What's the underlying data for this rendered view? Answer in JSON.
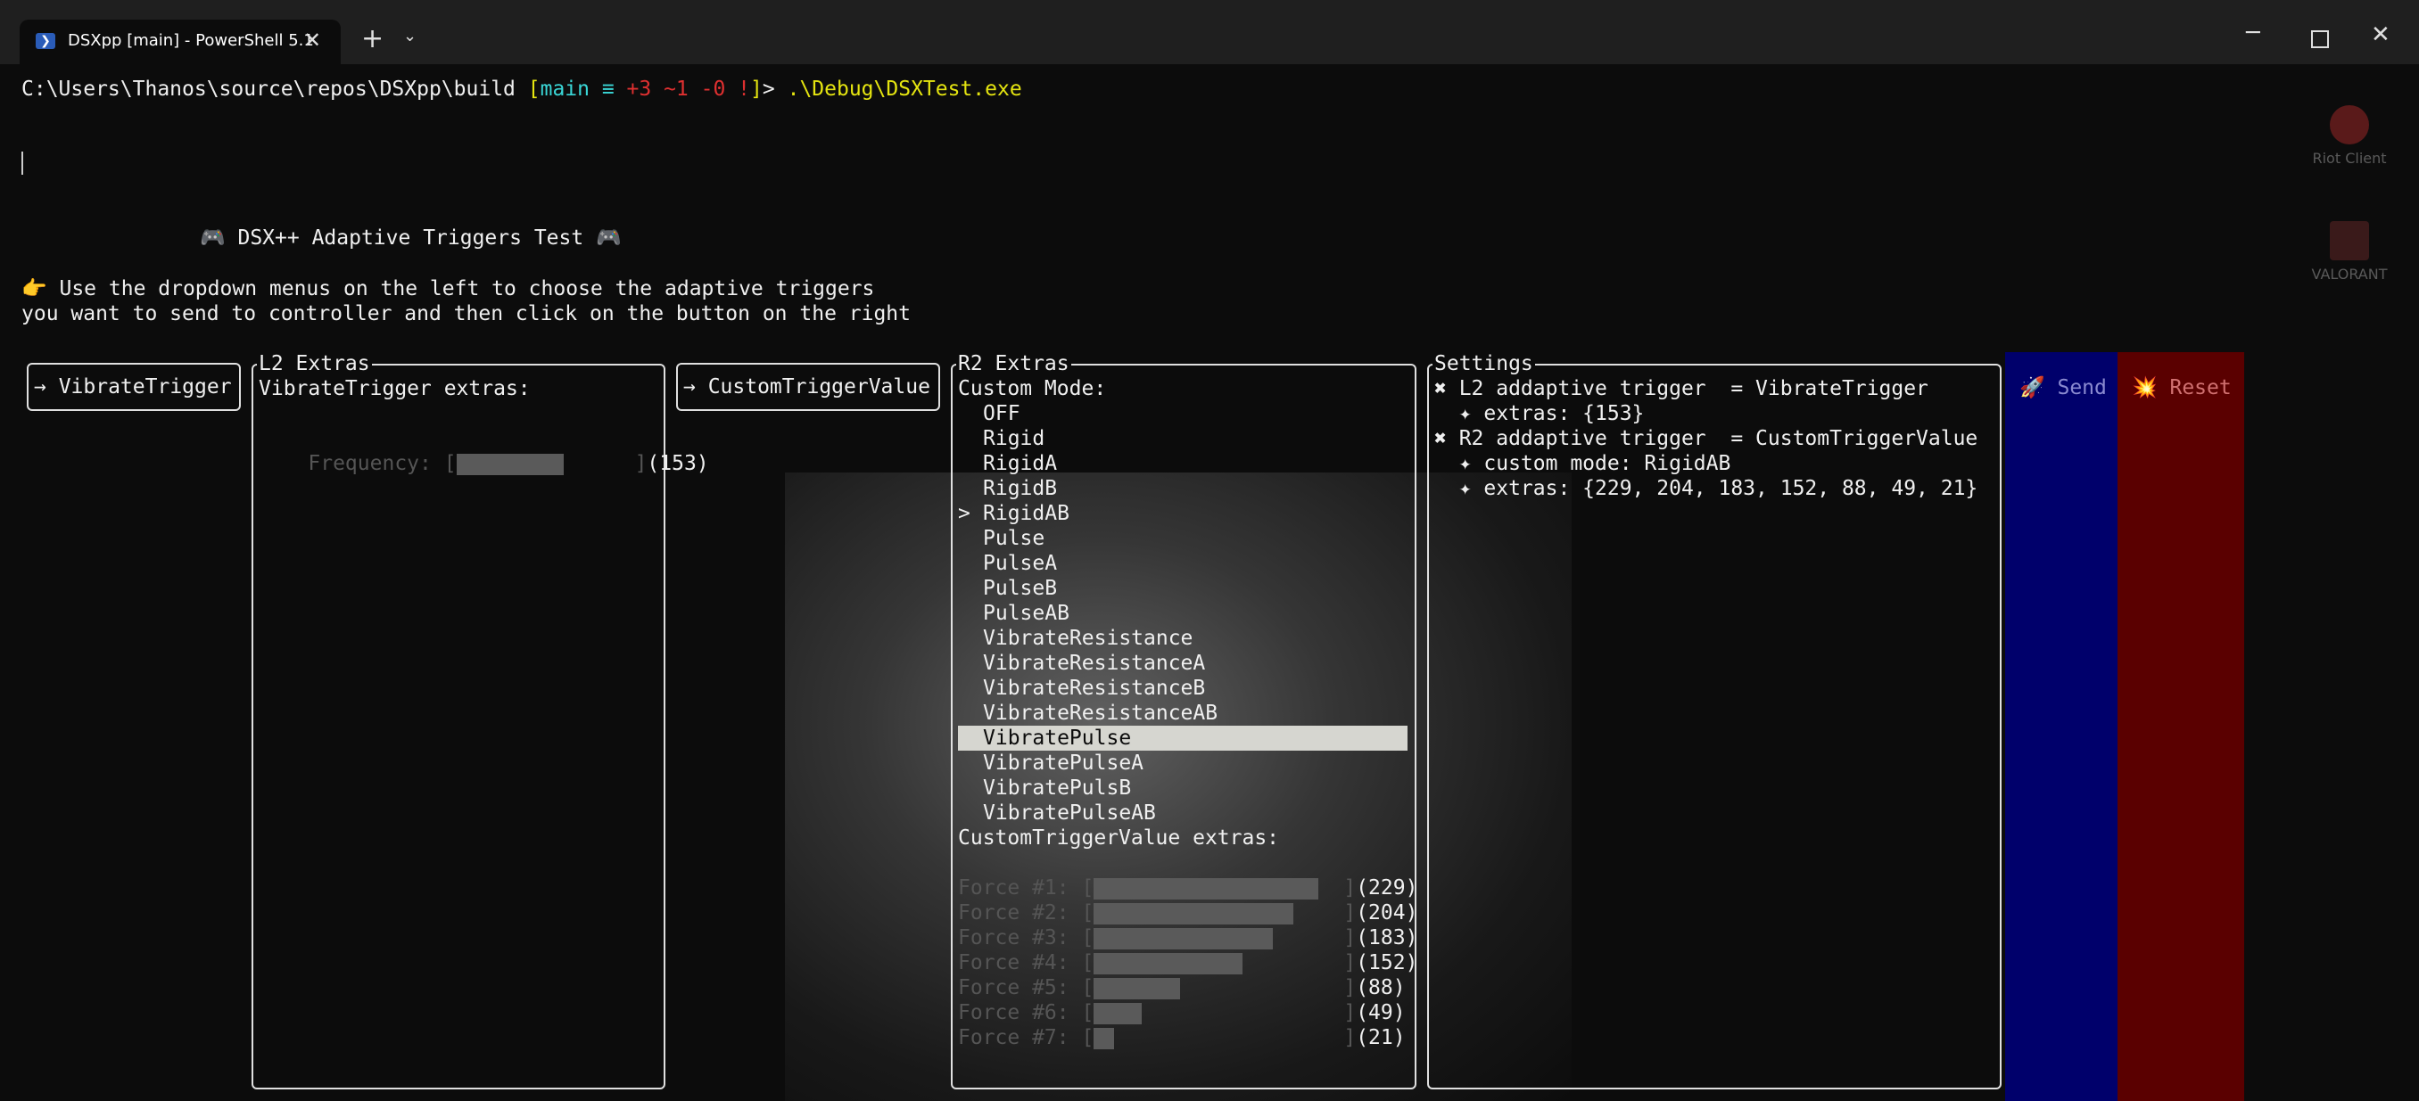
{
  "window": {
    "tab_title": "DSXpp [main] - PowerShell 5.1",
    "tab_icon": "powershell-icon",
    "close_tab_glyph": "✕",
    "new_tab_glyph": "+",
    "tab_dropdown_glyph": "⌄",
    "minimize_glyph": "─",
    "close_glyph": "✕"
  },
  "prompt": {
    "path": "C:\\Users\\Thanos\\source\\repos\\DSXpp\\build ",
    "bracket_open": "[",
    "branch": "main",
    "branch_status": " ≡ ",
    "added": "+3",
    "modified": " ~1",
    "deleted": " -0",
    "bang": " !",
    "bracket_close": "]",
    "arrow": "> ",
    "command": ".\\Debug\\DSXTest.exe"
  },
  "app": {
    "title": "🎮 DSX++ Adaptive Triggers Test 🎮",
    "instruction_line1": "👉 Use the dropdown menus on the left to choose the adaptive triggers",
    "instruction_line2": "you want to send to controller and then click on the button on the right"
  },
  "l2_dropdown": {
    "label": "→ VibrateTrigger"
  },
  "l2_extras": {
    "title": "L2 Extras",
    "heading": "VibrateTrigger extras:",
    "frequency_label": "Frequency: [",
    "frequency_close": "]",
    "frequency_value": 153,
    "frequency_display": "(153)"
  },
  "r2_dropdown": {
    "label": "→ CustomTriggerValue"
  },
  "r2_extras": {
    "title": "R2 Extras",
    "custom_mode_label": "Custom Mode:",
    "selected_marker": ">",
    "modes": [
      "OFF",
      "Rigid",
      "RigidA",
      "RigidB",
      "RigidAB",
      "Pulse",
      "PulseA",
      "PulseB",
      "PulseAB",
      "VibrateResistance",
      "VibrateResistanceA",
      "VibrateResistanceB",
      "VibrateResistanceAB",
      "VibratePulse",
      "VibratePulseA",
      "VibratePulsB",
      "VibratePulseAB"
    ],
    "selected_mode": "RigidAB",
    "highlighted_mode": "VibratePulse",
    "extras_heading": "CustomTriggerValue extras:",
    "forces": [
      {
        "label": "Force #1: [",
        "value": 229,
        "display": "(229)"
      },
      {
        "label": "Force #2: [",
        "value": 204,
        "display": "(204)"
      },
      {
        "label": "Force #3: [",
        "value": 183,
        "display": "(183)"
      },
      {
        "label": "Force #4: [",
        "value": 152,
        "display": "(152)"
      },
      {
        "label": "Force #5: [",
        "value": 88,
        "display": "(88)"
      },
      {
        "label": "Force #6: [",
        "value": 49,
        "display": "(49)"
      },
      {
        "label": "Force #7: [",
        "value": 21,
        "display": "(21)"
      }
    ],
    "bar_close": "]",
    "max_value": 255
  },
  "settings": {
    "title": "Settings",
    "l2_line": "✖ L2 addaptive trigger  = VibrateTrigger",
    "l2_extras_line": "  ✦ extras: {153}",
    "r2_line": "✖ R2 addaptive trigger  = CustomTriggerValue",
    "r2_mode_line": "  ✦ custom mode: RigidAB",
    "r2_extras_line": "  ✦ extras: {229, 204, 183, 152, 88, 49, 21}"
  },
  "buttons": {
    "send": "🚀 Send",
    "reset": "💥 Reset"
  },
  "desktop": {
    "icon1": "Riot Client",
    "icon2": "VALORANT"
  },
  "colors": {
    "branch": "#3ad7d7",
    "bracket": "#e5e510",
    "changes": "#e03030",
    "send_bg": "#00006b",
    "reset_bg": "#5a0000",
    "highlight_bg": "#d6d6d0"
  }
}
